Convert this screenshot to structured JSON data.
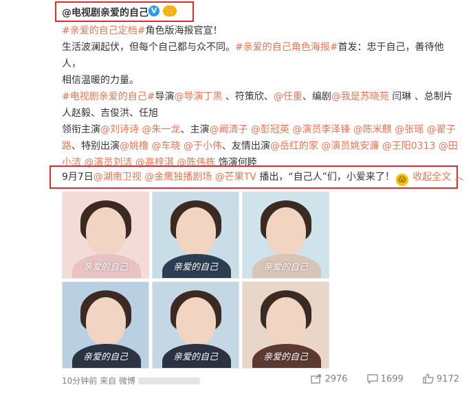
{
  "author": {
    "name": "@电视剧亲爱的自己",
    "verified_icon": "V",
    "level_badge": "👑"
  },
  "post": {
    "line1_tag": "#亲爱的自己定档#",
    "line1_text": "角色版海报官宣！",
    "line2_text": "生活波澜起伏，但每个自己都与众不同。",
    "line2_tag": "#亲爱的自己角色海报#",
    "line2_tail": "首发：忠于自己，善待他人，",
    "line3_text": "相信温暖的力量。",
    "line4_tag": "#电视剧亲爱的自己#",
    "line4_text_a": "导演",
    "line4_link_a": "@导演丁黑",
    "line4_text_b": "、符策欣、",
    "line4_link_b": "@任重",
    "line4_text_c": "、编剧",
    "line4_link_c": "@我是苏晓苑",
    "line4_text_d": "闫琳 、总制片",
    "line5_text": "人赵毅、吉俊洪、任旭",
    "line6_text_a": "领衔主演",
    "line6_link_a": "@刘诗诗",
    "line6_link_b": "@朱一龙",
    "line6_text_b": "、主演",
    "line6_link_c": "@阚清子",
    "line6_link_d": "@彭冠英",
    "line6_link_e": "@演员李泽锋",
    "line6_link_f": "@陈米麒",
    "line6_link_g": "@张瑶",
    "line6_link_h": "@翟子",
    "line7_link_a": "路",
    "line7_text_a": "、特别出演",
    "line7_link_b": "@姚橹",
    "line7_link_c": "@车晓",
    "line7_link_d": "@于小伟",
    "line7_text_b": "、友情出演",
    "line7_link_e": "@岳红的家",
    "line7_link_f": "@演员姚安濂",
    "line7_link_g": "@王阳0313",
    "line7_link_h": "@田",
    "line8_link_a": "小洁",
    "line8_link_b": "@演员刘洁",
    "line8_link_c": "@高梓淇",
    "line8_link_d": "@陈伟栋",
    "line8_text": "饰演何睦"
  },
  "second": {
    "date": "9月7日",
    "link_a": "@湖南卫视",
    "link_b": "@金鹰独播剧场",
    "link_c": "@芒果TV",
    "text": "播出，“自己人”们，小爱来了！",
    "emoji": "😱",
    "collapse_label": "收起全文 ︿"
  },
  "posters": [
    {
      "title": "亲爱的自己",
      "bg": "#f3dcd6",
      "body": "#e9c3c3"
    },
    {
      "title": "亲爱的自己",
      "bg": "#c8dde6",
      "body": "#2e3e52"
    },
    {
      "title": "亲爱的自己",
      "bg": "#cfe3ea",
      "body": "#d9c4b8"
    },
    {
      "title": "亲爱的自己",
      "bg": "#b9cfe2",
      "body": "#2a3442"
    },
    {
      "title": "亲爱的自己",
      "bg": "#c3d7e4",
      "body": "#2b3242"
    },
    {
      "title": "亲爱的自己",
      "bg": "#e9d6c8",
      "body": "#5c3a32"
    }
  ],
  "footer": {
    "time": "10分钟前",
    "source_prefix": "来自 微博"
  },
  "actions": {
    "repost": "2976",
    "comment": "1699",
    "like": "9172"
  }
}
